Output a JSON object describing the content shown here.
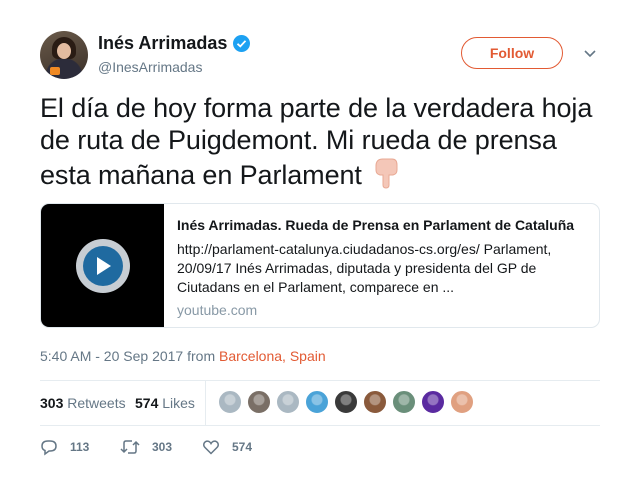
{
  "user": {
    "name": "Inés Arrimadas",
    "handle": "@InesArrimadas",
    "verified_icon": "verified-badge-icon"
  },
  "follow_label": "Follow",
  "tweet": {
    "text": "El día de hoy forma parte de la verdadera hoja de ruta de Puigdemont. Mi rueda de prensa esta mañana en Parlament",
    "emoji_icon": "pointing-down-hand-icon"
  },
  "card": {
    "title": "Inés Arrimadas. Rueda de Prensa en Parlament de Cataluña",
    "description": "http://parlament-catalunya.ciudadanos-cs.org/es/ Parlament, 20/09/17 Inés Arrimadas, diputada y presidenta del GP de Ciutadans en el Parlament, comparece en ...",
    "domain": "youtube.com",
    "play_icon": "play-icon"
  },
  "meta": {
    "timestamp": "5:40 AM - 20 Sep 2017 from ",
    "location": "Barcelona, Spain"
  },
  "stats": {
    "retweets_count": "303",
    "retweets_label": "Retweets",
    "likes_count": "574",
    "likes_label": "Likes"
  },
  "liker_avatars": [
    {
      "color": "#aab8c2"
    },
    {
      "color": "#7a6f66"
    },
    {
      "color": "#aab8c2"
    },
    {
      "color": "#4aa3d8"
    },
    {
      "color": "#3a3a3a"
    },
    {
      "color": "#8a5a3c"
    },
    {
      "color": "#6a8f7a"
    },
    {
      "color": "#5a2aa0"
    },
    {
      "color": "#e0a080"
    }
  ],
  "actions": {
    "reply_count": "113",
    "retweet_count": "303",
    "like_count": "574"
  },
  "colors": {
    "accent": "#e25a33",
    "verified": "#1da1f2",
    "muted": "#657786"
  }
}
